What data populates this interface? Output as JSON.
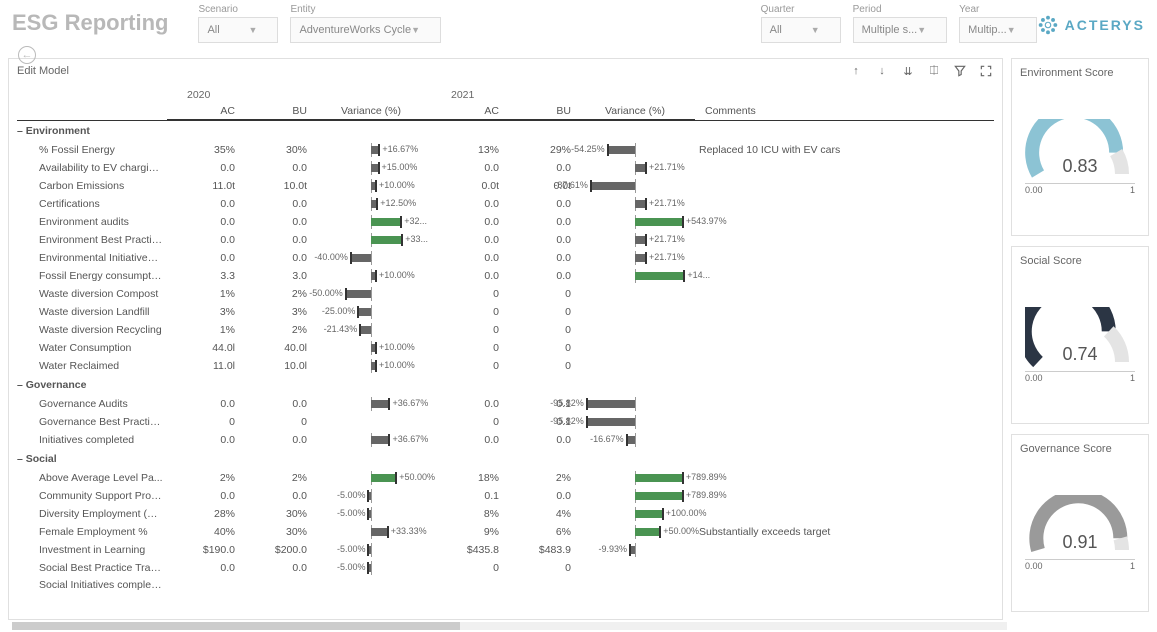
{
  "title": "ESG Reporting",
  "filters": {
    "scenario": {
      "label": "Scenario",
      "value": "All"
    },
    "entity": {
      "label": "Entity",
      "value": "AdventureWorks Cycle"
    },
    "quarter": {
      "label": "Quarter",
      "value": "All"
    },
    "period": {
      "label": "Period",
      "value": "Multiple s..."
    },
    "year": {
      "label": "Year",
      "value": "Multip..."
    }
  },
  "brand": "ACTERYS",
  "panel_title": "Edit Model",
  "years": {
    "y1": "2020",
    "y2": "2021"
  },
  "cols": {
    "ac": "AC",
    "bu": "BU",
    "var": "Variance (%)",
    "comments": "Comments"
  },
  "categories": [
    {
      "name": "Environment",
      "rows": [
        {
          "label": "% Fossil Energy",
          "ac1": "35%",
          "bu1": "30%",
          "v1": "+16.67%",
          "v1n": 16.67,
          "ac2": "13%",
          "bu2": "29%",
          "v2": "-54.25%",
          "v2n": -54.25,
          "comment": "Replaced 10 ICU with EV cars"
        },
        {
          "label": "Availability to EV chargin...",
          "ac1": "0.0",
          "bu1": "0.0",
          "v1": "+15.00%",
          "v1n": 15,
          "ac2": "0.0",
          "bu2": "0.0",
          "v2": "+21.71%",
          "v2n": 21.71,
          "comment": ""
        },
        {
          "label": "Carbon Emissions",
          "ac1": "11.0t",
          "bu1": "10.0t",
          "v1": "+10.00%",
          "v1n": 10,
          "ac2": "0.0t",
          "bu2": "0.0t",
          "v2": "-87.61%",
          "v2n": -87.61,
          "comment": ""
        },
        {
          "label": "Certifications",
          "ac1": "0.0",
          "bu1": "0.0",
          "v1": "+12.50%",
          "v1n": 12.5,
          "ac2": "0.0",
          "bu2": "0.0",
          "v2": "+21.71%",
          "v2n": 21.71,
          "comment": ""
        },
        {
          "label": "Environment audits",
          "ac1": "0.0",
          "bu1": "0.0",
          "v1": "+32...",
          "v1n": 60,
          "ac2": "0.0",
          "bu2": "0.0",
          "v2": "+543.97%",
          "v2n": 95,
          "comment": ""
        },
        {
          "label": "Environment Best Practic...",
          "ac1": "0.0",
          "bu1": "0.0",
          "v1": "+33...",
          "v1n": 62,
          "ac2": "0.0",
          "bu2": "0.0",
          "v2": "+21.71%",
          "v2n": 21.71,
          "comment": ""
        },
        {
          "label": "Environmental Initiatives ...",
          "ac1": "0.0",
          "bu1": "0.0",
          "v1": "-40.00%",
          "v1n": -40,
          "ac2": "0.0",
          "bu2": "0.0",
          "v2": "+21.71%",
          "v2n": 21.71,
          "comment": ""
        },
        {
          "label": "Fossil Energy consumptio...",
          "ac1": "3.3",
          "bu1": "3.0",
          "v1": "+10.00%",
          "v1n": 10,
          "ac2": "0.0",
          "bu2": "0.0",
          "v2": "+14...",
          "v2n": 98,
          "comment": ""
        },
        {
          "label": "Waste diversion Compost",
          "ac1": "1%",
          "bu1": "2%",
          "v1": "-50.00%",
          "v1n": -50,
          "ac2": "0",
          "bu2": "0",
          "v2": "",
          "v2n": null,
          "comment": ""
        },
        {
          "label": "Waste diversion Landfill",
          "ac1": "3%",
          "bu1": "3%",
          "v1": "-25.00%",
          "v1n": -25,
          "ac2": "0",
          "bu2": "0",
          "v2": "",
          "v2n": null,
          "comment": ""
        },
        {
          "label": "Waste diversion Recycling",
          "ac1": "1%",
          "bu1": "2%",
          "v1": "-21.43%",
          "v1n": -21.43,
          "ac2": "0",
          "bu2": "0",
          "v2": "",
          "v2n": null,
          "comment": ""
        },
        {
          "label": "Water Consumption",
          "ac1": "44.0l",
          "bu1": "40.0l",
          "v1": "+10.00%",
          "v1n": 10,
          "ac2": "0",
          "bu2": "0",
          "v2": "",
          "v2n": null,
          "comment": ""
        },
        {
          "label": "Water Reclaimed",
          "ac1": "11.0l",
          "bu1": "10.0l",
          "v1": "+10.00%",
          "v1n": 10,
          "ac2": "0",
          "bu2": "0",
          "v2": "",
          "v2n": null,
          "comment": ""
        }
      ]
    },
    {
      "name": "Governance",
      "rows": [
        {
          "label": "Governance Audits",
          "ac1": "0.0",
          "bu1": "0.0",
          "v1": "+36.67%",
          "v1n": 36.67,
          "ac2": "0.0",
          "bu2": "0.1",
          "v2": "-95.82%",
          "v2n": -95.82,
          "comment": ""
        },
        {
          "label": "Governance Best Practic...",
          "ac1": "0",
          "bu1": "0",
          "v1": "",
          "v1n": null,
          "ac2": "0",
          "bu2": "0.1",
          "v2": "-95.82%",
          "v2n": -95.82,
          "comment": ""
        },
        {
          "label": "Initiatives completed",
          "ac1": "0.0",
          "bu1": "0.0",
          "v1": "+36.67%",
          "v1n": 36.67,
          "ac2": "0.0",
          "bu2": "0.0",
          "v2": "-16.67%",
          "v2n": -16.67,
          "comment": ""
        }
      ]
    },
    {
      "name": "Social",
      "rows": [
        {
          "label": "Above Average Level Pa...",
          "ac1": "2%",
          "bu1": "2%",
          "v1": "+50.00%",
          "v1n": 50,
          "ac2": "18%",
          "bu2": "2%",
          "v2": "+789.89%",
          "v2n": 95,
          "comment": ""
        },
        {
          "label": "Community Support Proje...",
          "ac1": "0.0",
          "bu1": "0.0",
          "v1": "-5.00%",
          "v1n": -5,
          "ac2": "0.1",
          "bu2": "0.0",
          "v2": "+789.89%",
          "v2n": 95,
          "comment": ""
        },
        {
          "label": "Diversity Employment (N...",
          "ac1": "28%",
          "bu1": "30%",
          "v1": "-5.00%",
          "v1n": -5,
          "ac2": "8%",
          "bu2": "4%",
          "v2": "+100.00%",
          "v2n": 55,
          "comment": ""
        },
        {
          "label": "Female Employment %",
          "ac1": "40%",
          "bu1": "30%",
          "v1": "+33.33%",
          "v1n": 33.33,
          "ac2": "9%",
          "bu2": "6%",
          "v2": "+50.00%",
          "v2n": 50,
          "comment": "Substantially exceeds target"
        },
        {
          "label": "Investment in Learning",
          "ac1": "$190.0",
          "bu1": "$200.0",
          "v1": "-5.00%",
          "v1n": -5,
          "ac2": "$435.8",
          "bu2": "$483.9",
          "v2": "-9.93%",
          "v2n": -9.93,
          "comment": ""
        },
        {
          "label": "Social Best Practice Train...",
          "ac1": "0.0",
          "bu1": "0.0",
          "v1": "-5.00%",
          "v1n": -5,
          "ac2": "0",
          "bu2": "0",
          "v2": "",
          "v2n": null,
          "comment": ""
        },
        {
          "label": "Social Initiatives completed",
          "ac1": "",
          "bu1": "",
          "v1": "",
          "v1n": null,
          "ac2": "",
          "bu2": "",
          "v2": "",
          "v2n": null,
          "comment": ""
        }
      ]
    }
  ],
  "scores": {
    "env": {
      "title": "Environment Score",
      "value": "0.83",
      "num": 0.83,
      "min": "0.00",
      "max": "1",
      "color": "#8cc3d4"
    },
    "soc": {
      "title": "Social Score",
      "value": "0.74",
      "num": 0.74,
      "min": "0.00",
      "max": "1",
      "color": "#2b3544"
    },
    "gov": {
      "title": "Governance Score",
      "value": "0.91",
      "num": 0.91,
      "min": "0.00",
      "max": "1",
      "color": "#9a9a9a"
    }
  },
  "chart_data": [
    {
      "type": "gauge",
      "title": "Environment Score",
      "value": 0.83,
      "min": 0,
      "max": 1
    },
    {
      "type": "gauge",
      "title": "Social Score",
      "value": 0.74,
      "min": 0,
      "max": 1
    },
    {
      "type": "gauge",
      "title": "Governance Score",
      "value": 0.91,
      "min": 0,
      "max": 1
    }
  ]
}
